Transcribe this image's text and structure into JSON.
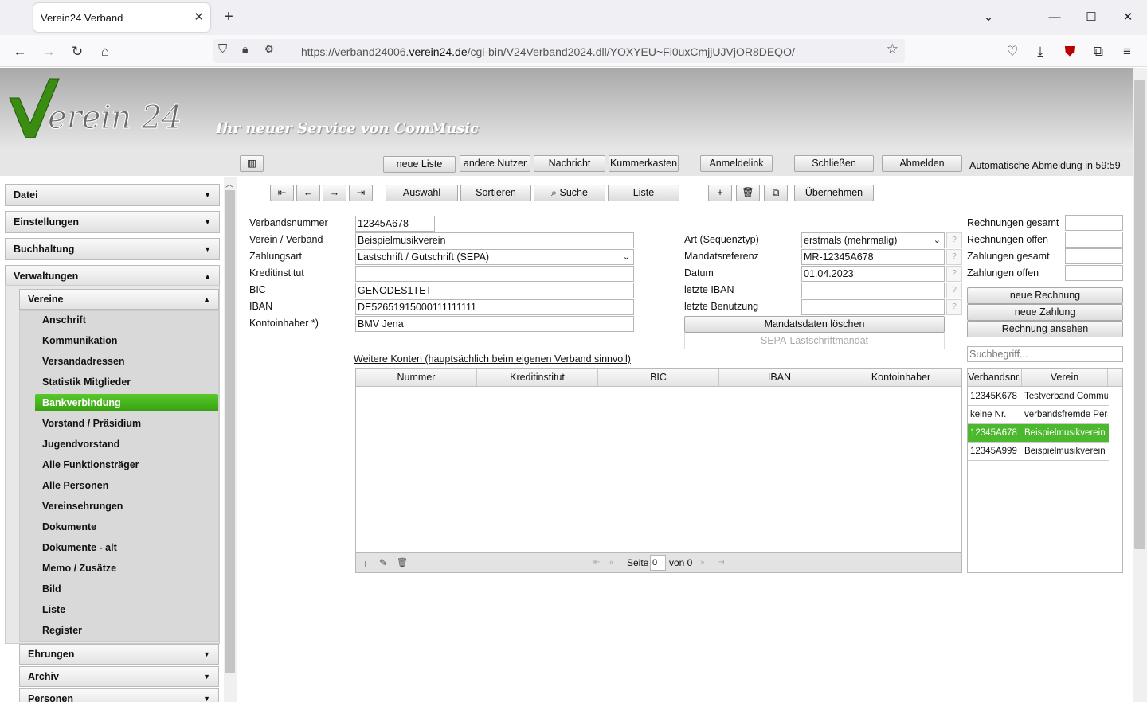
{
  "browser": {
    "tab_title": "Verein24 Verband",
    "url_prefix": "https://verband24006.",
    "url_domain": "verein24.de",
    "url_path": "/cgi-bin/V24Verband2024.dll/YOXYEU~Fi0uxCmjjUJVjOR8DEQO/"
  },
  "header": {
    "logo_text": "Verein 24",
    "slogan": "Ihr neuer Service von ComMusic"
  },
  "topbar": {
    "buttons": [
      "neue Liste",
      "andere Nutzer",
      "Nachricht",
      "Kummerkasten",
      "Anmeldelink",
      "Schließen",
      "Abmelden"
    ],
    "auto_logout": "Automatische Abmeldung in 59:59"
  },
  "sidebar": {
    "sections": [
      "Datei",
      "Einstellungen",
      "Buchhaltung",
      "Verwaltungen"
    ],
    "subsections": [
      "Vereine",
      "Ehrungen",
      "Archiv",
      "Personen"
    ],
    "items": [
      "Anschrift",
      "Kommunikation",
      "Versandadressen",
      "Statistik Mitglieder",
      "Bankverbindung",
      "Vorstand / Präsidium",
      "Jugendvorstand",
      "Alle Funktionsträger",
      "Alle Personen",
      "Vereinsehrungen",
      "Dokumente",
      "Dokumente - alt",
      "Memo / Zusätze",
      "Bild",
      "Liste",
      "Register"
    ],
    "selected_item": "Bankverbindung"
  },
  "toolbar": {
    "nav_icons": [
      "⇤",
      "←",
      "→",
      "⇥"
    ],
    "auswahl": "Auswahl",
    "sortieren": "Sortieren",
    "suche": "Suche",
    "liste": "Liste",
    "uebernehmen": "Übernehmen"
  },
  "form": {
    "labels": {
      "verbandsnummer": "Verbandsnummer",
      "verein": "Verein / Verband",
      "zahlungsart": "Zahlungsart",
      "kreditinstitut": "Kreditinstitut",
      "bic": "BIC",
      "iban": "IBAN",
      "kontoinhaber": "Kontoinhaber *)",
      "art": "Art (Sequenztyp)",
      "mandatsreferenz": "Mandatsreferenz",
      "datum": "Datum",
      "letzte_iban": "letzte IBAN",
      "letzte_benutzung": "letzte Benutzung"
    },
    "values": {
      "verbandsnummer": "12345A678",
      "verein": "Beispielmusikverein",
      "zahlungsart": "Lastschrift / Gutschrift (SEPA)",
      "kreditinstitut": "",
      "bic": "GENODES1TET",
      "iban": "DE52651915000111111111",
      "kontoinhaber": "BMV Jena",
      "art": "erstmals (mehrmalig)",
      "mandatsreferenz": "MR-12345A678",
      "datum": "01.04.2023",
      "letzte_iban": "",
      "letzte_benutzung": ""
    },
    "help_mark": "?",
    "mandatsdaten_loeschen": "Mandatsdaten löschen",
    "sepa_mandat": "SEPA-Lastschriftmandat"
  },
  "konten": {
    "link": "Weitere Konten (hauptsächlich beim eigenen Verband sinnvoll)",
    "columns": [
      "Nummer",
      "Kreditinstitut",
      "BIC",
      "IBAN",
      "Kontoinhaber"
    ],
    "pager": {
      "seite_label": "Seite",
      "page": "0",
      "von_label": "von 0"
    }
  },
  "rechnungen": {
    "labels": [
      "Rechnungen gesamt",
      "Rechnungen offen",
      "Zahlungen gesamt",
      "Zahlungen offen"
    ],
    "buttons": [
      "neue Rechnung",
      "neue Zahlung",
      "Rechnung ansehen"
    ],
    "search_placeholder": "Suchbegriff..."
  },
  "verbandsliste": {
    "columns": [
      "Verbandsnr.",
      "Verein"
    ],
    "rows": [
      {
        "nr": "12345K678",
        "verein": "Testverband Commu"
      },
      {
        "nr": "keine Nr.",
        "verein": "verbandsfremde Pers"
      },
      {
        "nr": "12345A678",
        "verein": "Beispielmusikverein"
      },
      {
        "nr": "12345A999",
        "verein": "Beispielmusikverein ."
      }
    ],
    "selected_index": 2
  },
  "colors": {
    "accent_green": "#4cb82d",
    "header_gray": "#b4b4b4"
  }
}
